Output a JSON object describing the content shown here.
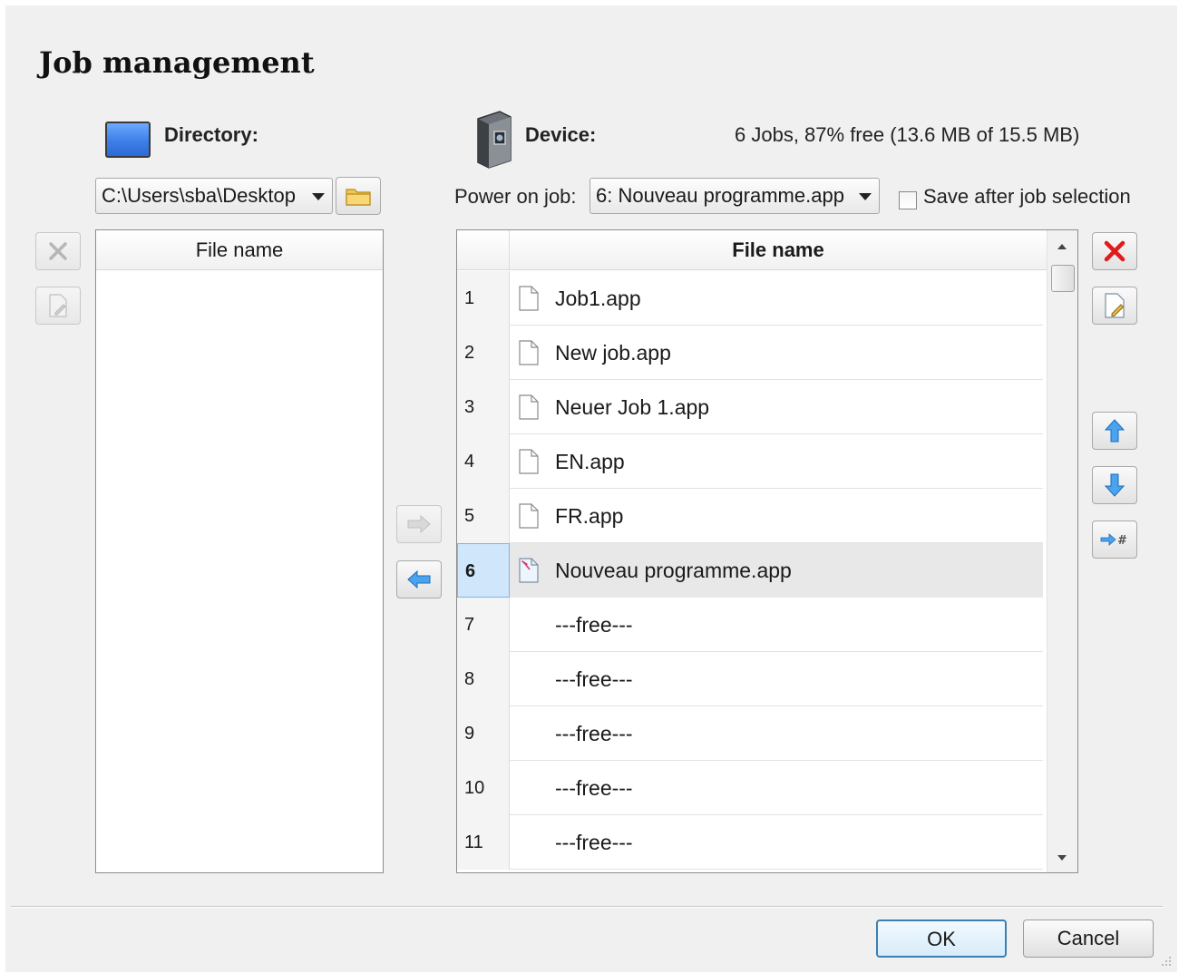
{
  "title": "Job management",
  "directory": {
    "label": "Directory:",
    "path": "C:\\Users\\sba\\Desktop",
    "list_header": "File name",
    "files": []
  },
  "device": {
    "label": "Device:",
    "status": "6 Jobs, 87% free (13.6 MB of 15.5 MB)",
    "power_on_label": "Power on job:",
    "power_on_value": "6: Nouveau programme.app",
    "save_after_label": "Save after job selection",
    "save_after_checked": false,
    "list_header": "File name",
    "jobs": [
      {
        "num": "1",
        "name": "Job1.app",
        "icon": "file-icon"
      },
      {
        "num": "2",
        "name": "New job.app",
        "icon": "file-icon"
      },
      {
        "num": "3",
        "name": "Neuer Job 1.app",
        "icon": "file-icon"
      },
      {
        "num": "4",
        "name": "EN.app",
        "icon": "file-icon"
      },
      {
        "num": "5",
        "name": "FR.app",
        "icon": "file-icon"
      },
      {
        "num": "6",
        "name": "Nouveau programme.app",
        "icon": "power-on-file-icon",
        "selected": true
      },
      {
        "num": "7",
        "name": "---free---"
      },
      {
        "num": "8",
        "name": "---free---"
      },
      {
        "num": "9",
        "name": "---free---"
      },
      {
        "num": "10",
        "name": "---free---"
      },
      {
        "num": "11",
        "name": "---free---"
      }
    ]
  },
  "buttons": {
    "ok": "OK",
    "cancel": "Cancel"
  }
}
